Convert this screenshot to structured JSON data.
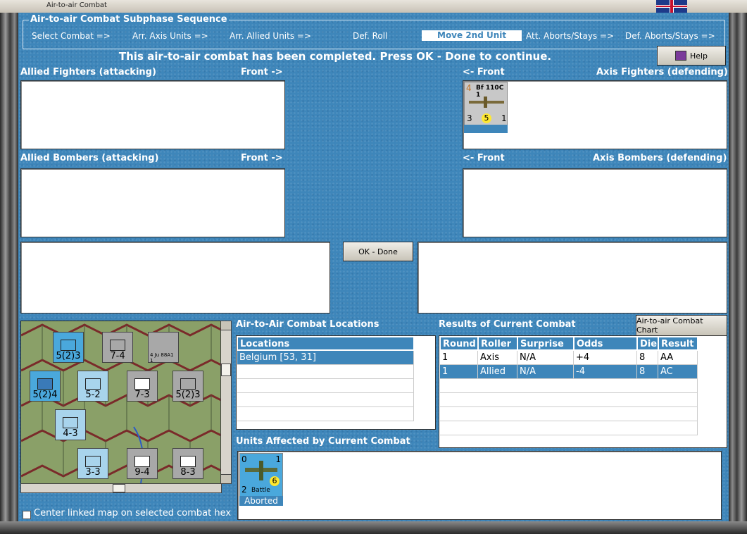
{
  "window": {
    "title": "Air-to-air Combat"
  },
  "sequence": {
    "title": "Air-to-air Combat Subphase Sequence",
    "steps": [
      "Select Combat =>",
      "Arr. Axis Units =>",
      "Arr. Allied Units =>",
      "Def. Roll",
      "Move 2nd Unit",
      "Att. Aborts/Stays =>",
      "Def. Aborts/Stays =>"
    ],
    "active_index": 4
  },
  "message": "This air-to-air combat has been completed.  Press OK - Done to continue.",
  "help_label": "Help",
  "panels": {
    "allied_fighters": "Allied Fighters (attacking)",
    "axis_fighters": "Axis Fighters (defending)",
    "allied_bombers": "Allied Bombers (attacking)",
    "axis_bombers": "Axis Bombers (defending)",
    "front_right": "Front ->",
    "front_left": "<- Front"
  },
  "axis_fighter_unit": {
    "name": "Bf 110C 1",
    "top_left": "4",
    "bottom_left": "3",
    "die": "5",
    "bottom_right": "1"
  },
  "ok_label": "OK - Done",
  "locations": {
    "title": "Air-to-Air Combat Locations",
    "header": "Locations",
    "rows": [
      "Belgium [53, 31]"
    ]
  },
  "results": {
    "title": "Results of Current Combat",
    "chart_button": "Air-to-air Combat Chart",
    "headers": [
      "Round",
      "Roller",
      "Surprise",
      "Odds",
      "Die",
      "Result"
    ],
    "rows": [
      [
        "1",
        "Axis",
        "N/A",
        "+4",
        "8",
        "AA"
      ],
      [
        "1",
        "Allied",
        "N/A",
        "-4",
        "8",
        "AC"
      ]
    ]
  },
  "affected": {
    "title": "Units Affected by Current Combat",
    "unit_label": "Battle",
    "top_left": "0",
    "top_right": "1",
    "bottom_left": "2",
    "die": "6",
    "status": "Aborted"
  },
  "map": {
    "units": [
      {
        "top": "XXX",
        "num": "5(2)3"
      },
      {
        "top": "XXX",
        "num": "7-4"
      },
      {
        "top": "2",
        "num": "4 Ju 88A1 1"
      },
      {
        "top": "XXXXX",
        "num": "5(2)4"
      },
      {
        "top": "XX",
        "num": "5-2"
      },
      {
        "top": "XXX",
        "num": "7-3"
      },
      {
        "top": "XXXXX",
        "num": "5(2)3"
      },
      {
        "top": "XXX",
        "num": "4-3"
      },
      {
        "top": "XX",
        "num": "3-3"
      },
      {
        "top": "XXX",
        "num": "9-4"
      },
      {
        "top": "XXX",
        "num": "8-3"
      }
    ]
  },
  "center_map_label": "Center linked map on selected combat hex"
}
